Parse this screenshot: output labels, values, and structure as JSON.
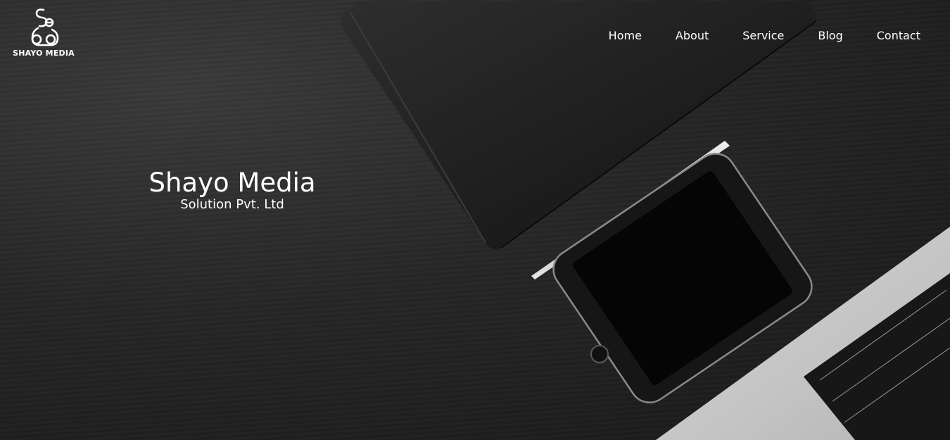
{
  "brand": {
    "logo_icon": "mascot-logo-icon",
    "name": "SHAYO MEDIA"
  },
  "nav": {
    "items": [
      {
        "label": "Home"
      },
      {
        "label": "About"
      },
      {
        "label": "Service"
      },
      {
        "label": "Blog"
      },
      {
        "label": "Contact"
      }
    ]
  },
  "hero": {
    "title": "Shayo Media",
    "subtitle": "Solution Pvt. Ltd"
  },
  "colors": {
    "text": "#ffffff",
    "background": "#262626"
  }
}
